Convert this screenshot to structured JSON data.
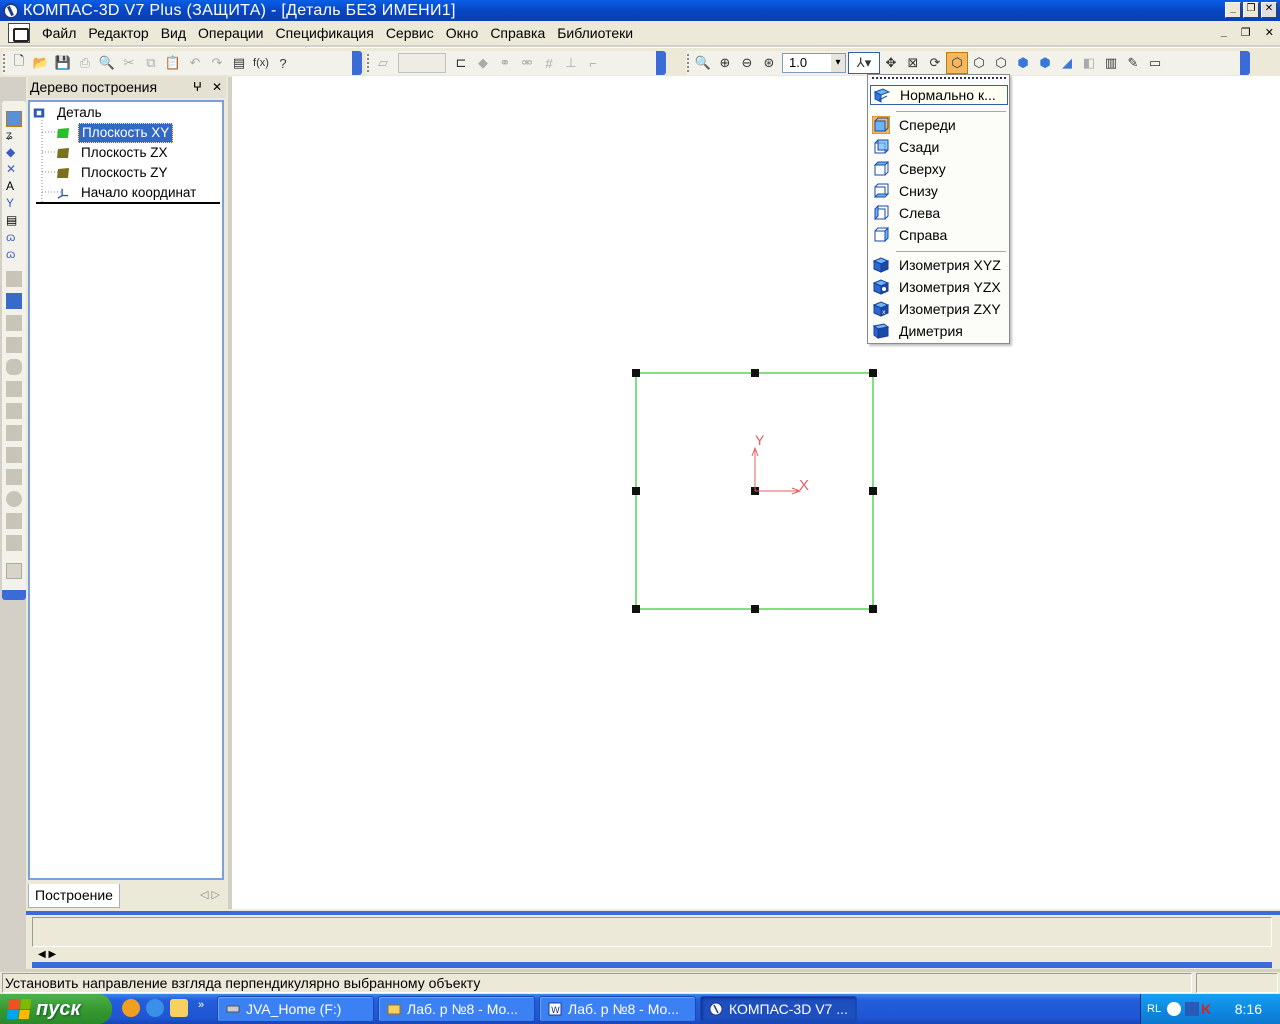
{
  "window": {
    "title": "КОМПАС-3D V7 Plus (ЗАЩИТА) - [Деталь БЕЗ ИМЕНИ1]"
  },
  "menu": {
    "items": [
      "Файл",
      "Редактор",
      "Вид",
      "Операции",
      "Спецификация",
      "Сервис",
      "Окно",
      "Справка",
      "Библиотеки"
    ]
  },
  "toolbar": {
    "zoom_value": "1.0"
  },
  "tree": {
    "header": "Дерево построения",
    "root": "Деталь",
    "items": [
      "Плоскость XY",
      "Плоскость ZX",
      "Плоскость ZY",
      "Начало координат"
    ],
    "selected_index": 0,
    "tab": "Построение"
  },
  "sketch": {
    "axis_y": "Y",
    "axis_x": "X",
    "frame_color": "#00c000",
    "axis_color": "#e06060"
  },
  "orientation_menu": {
    "items": [
      {
        "label": "Нормально к...",
        "icon": "normal-view-icon"
      },
      {
        "label": "Спереди",
        "icon": "front-view-icon"
      },
      {
        "label": "Сзади",
        "icon": "back-view-icon"
      },
      {
        "label": "Сверху",
        "icon": "top-view-icon"
      },
      {
        "label": "Снизу",
        "icon": "bottom-view-icon"
      },
      {
        "label": "Слева",
        "icon": "left-view-icon"
      },
      {
        "label": "Справа",
        "icon": "right-view-icon"
      },
      {
        "label": "Изометрия XYZ",
        "icon": "isometric-xyz-icon"
      },
      {
        "label": "Изометрия YZX",
        "icon": "isometric-yzx-icon"
      },
      {
        "label": "Изометрия ZXY",
        "icon": "isometric-zxy-icon"
      },
      {
        "label": "Диметрия",
        "icon": "dimetric-icon"
      }
    ],
    "highlighted_index": 0
  },
  "status": {
    "text": "Установить направление взгляда перпендикулярно выбранному объекту"
  },
  "taskbar": {
    "start": "пуск",
    "tasks": [
      "JVA_Home (F:)",
      "Лаб. р №8 - Мо...",
      "Лаб. р №8 - Мо...",
      "КОМПАС-3D V7 ..."
    ],
    "active_index": 3,
    "lang": "RL",
    "time": "8:16"
  }
}
